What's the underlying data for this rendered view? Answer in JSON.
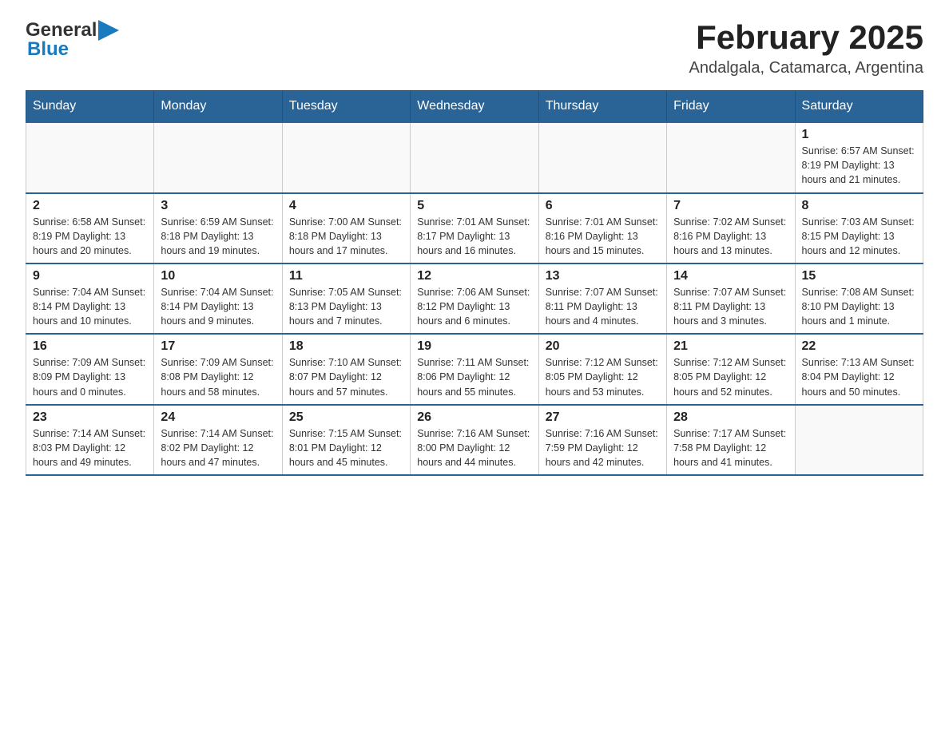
{
  "logo": {
    "general": "General",
    "blue": "Blue"
  },
  "header": {
    "title": "February 2025",
    "location": "Andalgala, Catamarca, Argentina"
  },
  "days_of_week": [
    "Sunday",
    "Monday",
    "Tuesday",
    "Wednesday",
    "Thursday",
    "Friday",
    "Saturday"
  ],
  "weeks": [
    [
      {
        "day": "",
        "info": ""
      },
      {
        "day": "",
        "info": ""
      },
      {
        "day": "",
        "info": ""
      },
      {
        "day": "",
        "info": ""
      },
      {
        "day": "",
        "info": ""
      },
      {
        "day": "",
        "info": ""
      },
      {
        "day": "1",
        "info": "Sunrise: 6:57 AM\nSunset: 8:19 PM\nDaylight: 13 hours and 21 minutes."
      }
    ],
    [
      {
        "day": "2",
        "info": "Sunrise: 6:58 AM\nSunset: 8:19 PM\nDaylight: 13 hours and 20 minutes."
      },
      {
        "day": "3",
        "info": "Sunrise: 6:59 AM\nSunset: 8:18 PM\nDaylight: 13 hours and 19 minutes."
      },
      {
        "day": "4",
        "info": "Sunrise: 7:00 AM\nSunset: 8:18 PM\nDaylight: 13 hours and 17 minutes."
      },
      {
        "day": "5",
        "info": "Sunrise: 7:01 AM\nSunset: 8:17 PM\nDaylight: 13 hours and 16 minutes."
      },
      {
        "day": "6",
        "info": "Sunrise: 7:01 AM\nSunset: 8:16 PM\nDaylight: 13 hours and 15 minutes."
      },
      {
        "day": "7",
        "info": "Sunrise: 7:02 AM\nSunset: 8:16 PM\nDaylight: 13 hours and 13 minutes."
      },
      {
        "day": "8",
        "info": "Sunrise: 7:03 AM\nSunset: 8:15 PM\nDaylight: 13 hours and 12 minutes."
      }
    ],
    [
      {
        "day": "9",
        "info": "Sunrise: 7:04 AM\nSunset: 8:14 PM\nDaylight: 13 hours and 10 minutes."
      },
      {
        "day": "10",
        "info": "Sunrise: 7:04 AM\nSunset: 8:14 PM\nDaylight: 13 hours and 9 minutes."
      },
      {
        "day": "11",
        "info": "Sunrise: 7:05 AM\nSunset: 8:13 PM\nDaylight: 13 hours and 7 minutes."
      },
      {
        "day": "12",
        "info": "Sunrise: 7:06 AM\nSunset: 8:12 PM\nDaylight: 13 hours and 6 minutes."
      },
      {
        "day": "13",
        "info": "Sunrise: 7:07 AM\nSunset: 8:11 PM\nDaylight: 13 hours and 4 minutes."
      },
      {
        "day": "14",
        "info": "Sunrise: 7:07 AM\nSunset: 8:11 PM\nDaylight: 13 hours and 3 minutes."
      },
      {
        "day": "15",
        "info": "Sunrise: 7:08 AM\nSunset: 8:10 PM\nDaylight: 13 hours and 1 minute."
      }
    ],
    [
      {
        "day": "16",
        "info": "Sunrise: 7:09 AM\nSunset: 8:09 PM\nDaylight: 13 hours and 0 minutes."
      },
      {
        "day": "17",
        "info": "Sunrise: 7:09 AM\nSunset: 8:08 PM\nDaylight: 12 hours and 58 minutes."
      },
      {
        "day": "18",
        "info": "Sunrise: 7:10 AM\nSunset: 8:07 PM\nDaylight: 12 hours and 57 minutes."
      },
      {
        "day": "19",
        "info": "Sunrise: 7:11 AM\nSunset: 8:06 PM\nDaylight: 12 hours and 55 minutes."
      },
      {
        "day": "20",
        "info": "Sunrise: 7:12 AM\nSunset: 8:05 PM\nDaylight: 12 hours and 53 minutes."
      },
      {
        "day": "21",
        "info": "Sunrise: 7:12 AM\nSunset: 8:05 PM\nDaylight: 12 hours and 52 minutes."
      },
      {
        "day": "22",
        "info": "Sunrise: 7:13 AM\nSunset: 8:04 PM\nDaylight: 12 hours and 50 minutes."
      }
    ],
    [
      {
        "day": "23",
        "info": "Sunrise: 7:14 AM\nSunset: 8:03 PM\nDaylight: 12 hours and 49 minutes."
      },
      {
        "day": "24",
        "info": "Sunrise: 7:14 AM\nSunset: 8:02 PM\nDaylight: 12 hours and 47 minutes."
      },
      {
        "day": "25",
        "info": "Sunrise: 7:15 AM\nSunset: 8:01 PM\nDaylight: 12 hours and 45 minutes."
      },
      {
        "day": "26",
        "info": "Sunrise: 7:16 AM\nSunset: 8:00 PM\nDaylight: 12 hours and 44 minutes."
      },
      {
        "day": "27",
        "info": "Sunrise: 7:16 AM\nSunset: 7:59 PM\nDaylight: 12 hours and 42 minutes."
      },
      {
        "day": "28",
        "info": "Sunrise: 7:17 AM\nSunset: 7:58 PM\nDaylight: 12 hours and 41 minutes."
      },
      {
        "day": "",
        "info": ""
      }
    ]
  ],
  "colors": {
    "header_bg": "#2a6496",
    "header_text": "#ffffff",
    "border": "#cccccc",
    "row_border": "#2a6496"
  }
}
